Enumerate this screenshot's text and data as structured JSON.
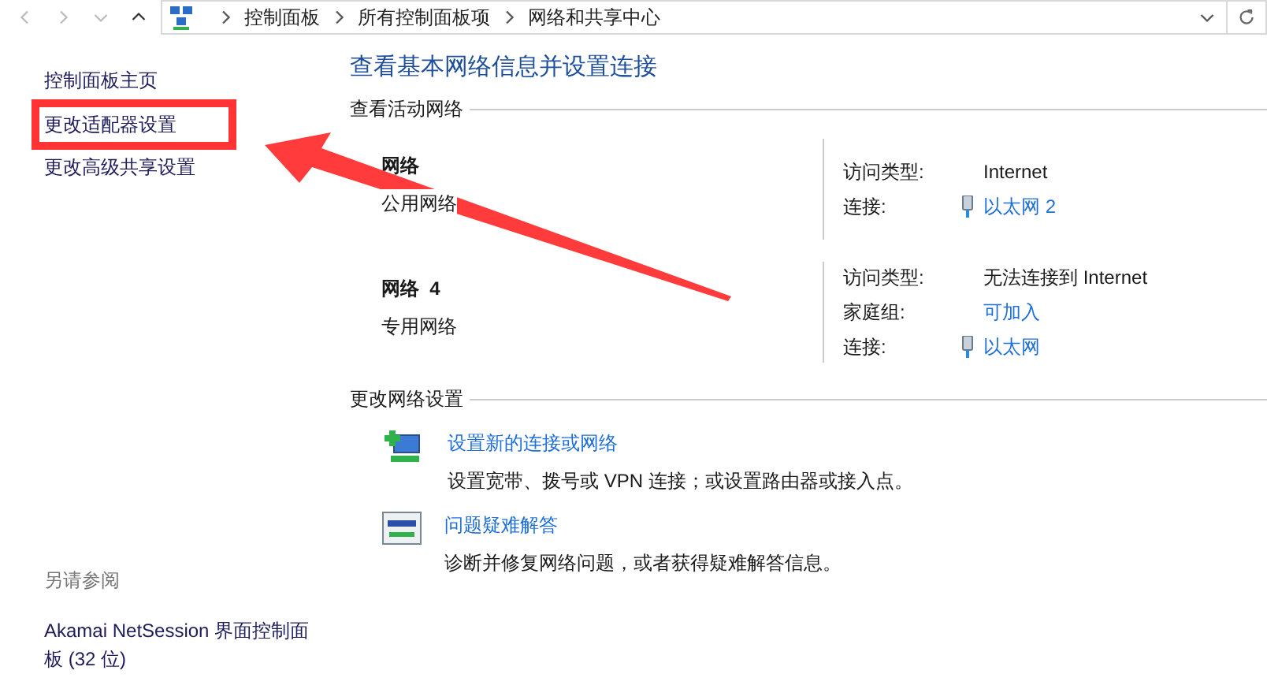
{
  "address_bar": {
    "breadcrumbs": [
      "控制面板",
      "所有控制面板项",
      "网络和共享中心"
    ]
  },
  "sidebar": {
    "links": [
      {
        "label": "控制面板主页",
        "highlighted": false
      },
      {
        "label": "更改适配器设置",
        "highlighted": true
      },
      {
        "label": "更改高级共享设置",
        "highlighted": false
      }
    ],
    "see_also": {
      "heading": "另请参阅",
      "links": [
        "Akamai NetSession 界面控制面板 (32 位)"
      ]
    }
  },
  "main": {
    "title": "查看基本网络信息并设置连接",
    "active_networks": {
      "heading": "查看活动网络",
      "networks": [
        {
          "name": "网络",
          "category": "公用网络",
          "details": [
            {
              "kind": "text",
              "label": "访问类型:",
              "value": "Internet"
            },
            {
              "kind": "connection",
              "label": "连接:",
              "value": "以太网 2"
            }
          ]
        },
        {
          "name": "网络  4",
          "category": "专用网络",
          "details": [
            {
              "kind": "text",
              "label": "访问类型:",
              "value": "无法连接到 Internet"
            },
            {
              "kind": "link",
              "label": "家庭组:",
              "value": "可加入"
            },
            {
              "kind": "connection",
              "label": "连接:",
              "value": "以太网"
            }
          ]
        }
      ]
    },
    "change_settings": {
      "heading": "更改网络设置",
      "tasks": [
        {
          "kind": "new-connection",
          "title": "设置新的连接或网络",
          "description": "设置宽带、拨号或 VPN 连接；或设置路由器或接入点。"
        },
        {
          "kind": "troubleshoot",
          "title": "问题疑难解答",
          "description": "诊断并修复网络问题，或者获得疑难解答信息。"
        }
      ]
    }
  }
}
